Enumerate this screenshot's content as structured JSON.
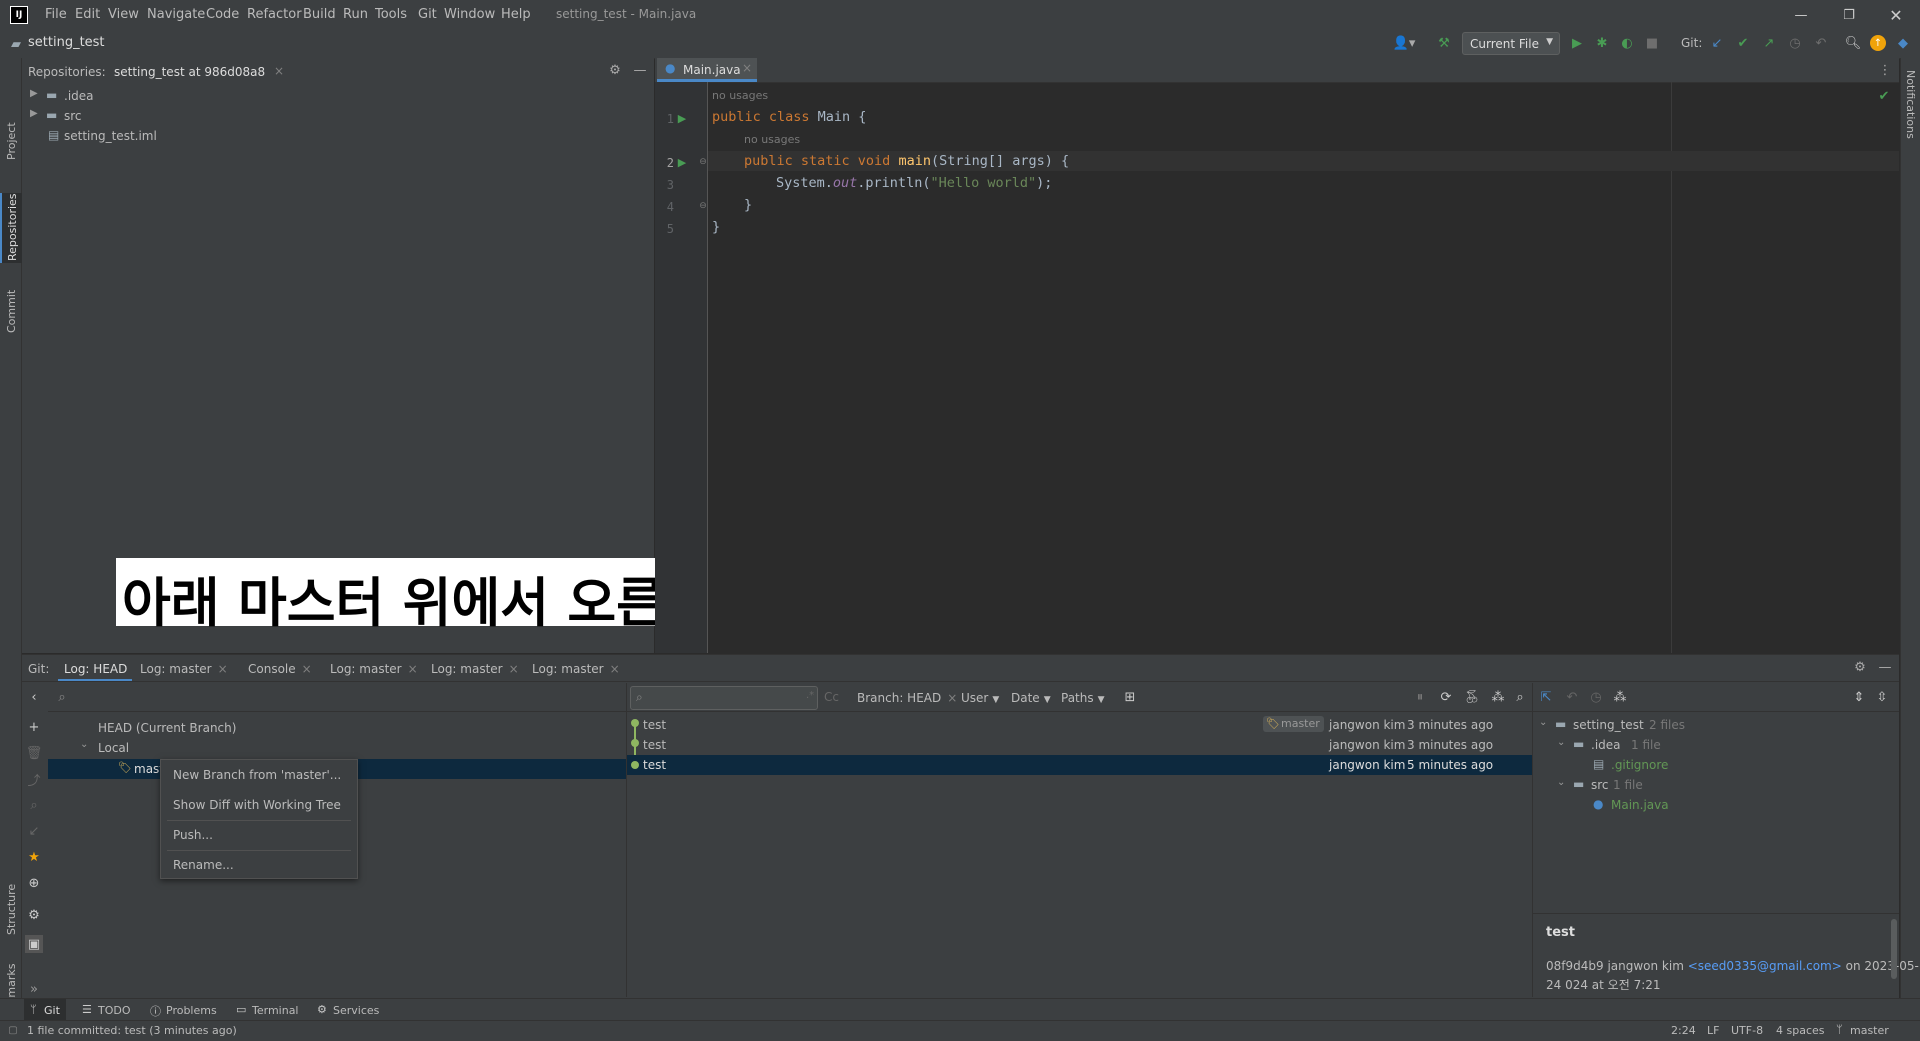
{
  "app": {
    "logo": "IJ",
    "window_title": "setting_test - Main.java",
    "project_name": "setting_test"
  },
  "menu": [
    "File",
    "Edit",
    "View",
    "Navigate",
    "Code",
    "Refactor",
    "Build",
    "Run",
    "Tools",
    "Git",
    "Window",
    "Help"
  ],
  "toolbar": {
    "run_config": "Current File",
    "git_label": "Git:"
  },
  "left_strip": {
    "project": "Project",
    "repositories": "Repositories",
    "commit": "Commit",
    "structure": "Structure",
    "bookmarks": "Bookmarks"
  },
  "right_strip": {
    "notifications": "Notifications"
  },
  "project_panel": {
    "header_label": "Repositories:",
    "tab": "setting_test at 986d08a8",
    "tree": [
      {
        "label": ".idea",
        "type": "folder"
      },
      {
        "label": "src",
        "type": "folder"
      },
      {
        "label": "setting_test.iml",
        "type": "file"
      }
    ]
  },
  "editor": {
    "tab": "Main.java",
    "hints": [
      "no usages",
      "no usages"
    ],
    "line_numbers": [
      "1",
      "2",
      "3",
      "4",
      "5"
    ],
    "code": {
      "l1_kw": "public class ",
      "l1_name": "Main {",
      "l2_kw": "public static void ",
      "l2_fn": "main",
      "l2_rest": "(String[] args) {",
      "l3_a": "System.",
      "l3_out": "out",
      "l3_b": ".println(",
      "l3_str": "\"Hello world\"",
      "l3_c": ");",
      "l4": "}",
      "l5": "}"
    }
  },
  "overlay_caption": "아래 마스터 위에서 오른쪽 클릭 후 푸쉬",
  "git_panel": {
    "prefix": "Git:",
    "tabs": [
      "Log: HEAD",
      "Log: master",
      "Console",
      "Log: master",
      "Log: master",
      "Log: master"
    ],
    "branches": {
      "head": "HEAD (Current Branch)",
      "local": "Local",
      "master": "master"
    },
    "context_menu": [
      "New Branch from 'master'...",
      "Show Diff with Working Tree",
      "Push...",
      "Rename..."
    ],
    "filters": {
      "branch": "Branch: HEAD",
      "user": "User",
      "date": "Date",
      "paths": "Paths",
      "cc": "Cc"
    },
    "commits": [
      {
        "msg": "test",
        "tag": "master",
        "author": "jangwon kim",
        "time": "3 minutes ago"
      },
      {
        "msg": "test",
        "tag": "",
        "author": "jangwon kim",
        "time": "3 minutes ago"
      },
      {
        "msg": "test",
        "tag": "",
        "author": "jangwon kim",
        "time": "5 minutes ago"
      }
    ],
    "changes": {
      "root": "setting_test",
      "root_count": "2 files",
      "idea": ".idea",
      "idea_count": "1 file",
      "gitignore": ".gitignore",
      "src": "src",
      "src_count": "1 file",
      "main": "Main.java"
    },
    "details": {
      "title": "test",
      "line1_prefix": "08f9d4b9 jangwon kim ",
      "email": "<seed0335@gmail.com>",
      "line1_suffix": " on 2023-05-",
      "line2": "24 024 at 오전 7:21"
    }
  },
  "bottom_tabs": [
    "Git",
    "TODO",
    "Problems",
    "Terminal",
    "Services"
  ],
  "status": {
    "message": "1 file committed: test (3 minutes ago)",
    "position": "2:24",
    "line_sep": "LF",
    "encoding": "UTF-8",
    "indent": "4 spaces",
    "branch": "master"
  },
  "colors": {
    "accent": "#4a88c7",
    "run_green": "#499c54",
    "keyword": "#cc7832",
    "string": "#6a8759",
    "function": "#ffc66d",
    "static": "#9876aa"
  }
}
